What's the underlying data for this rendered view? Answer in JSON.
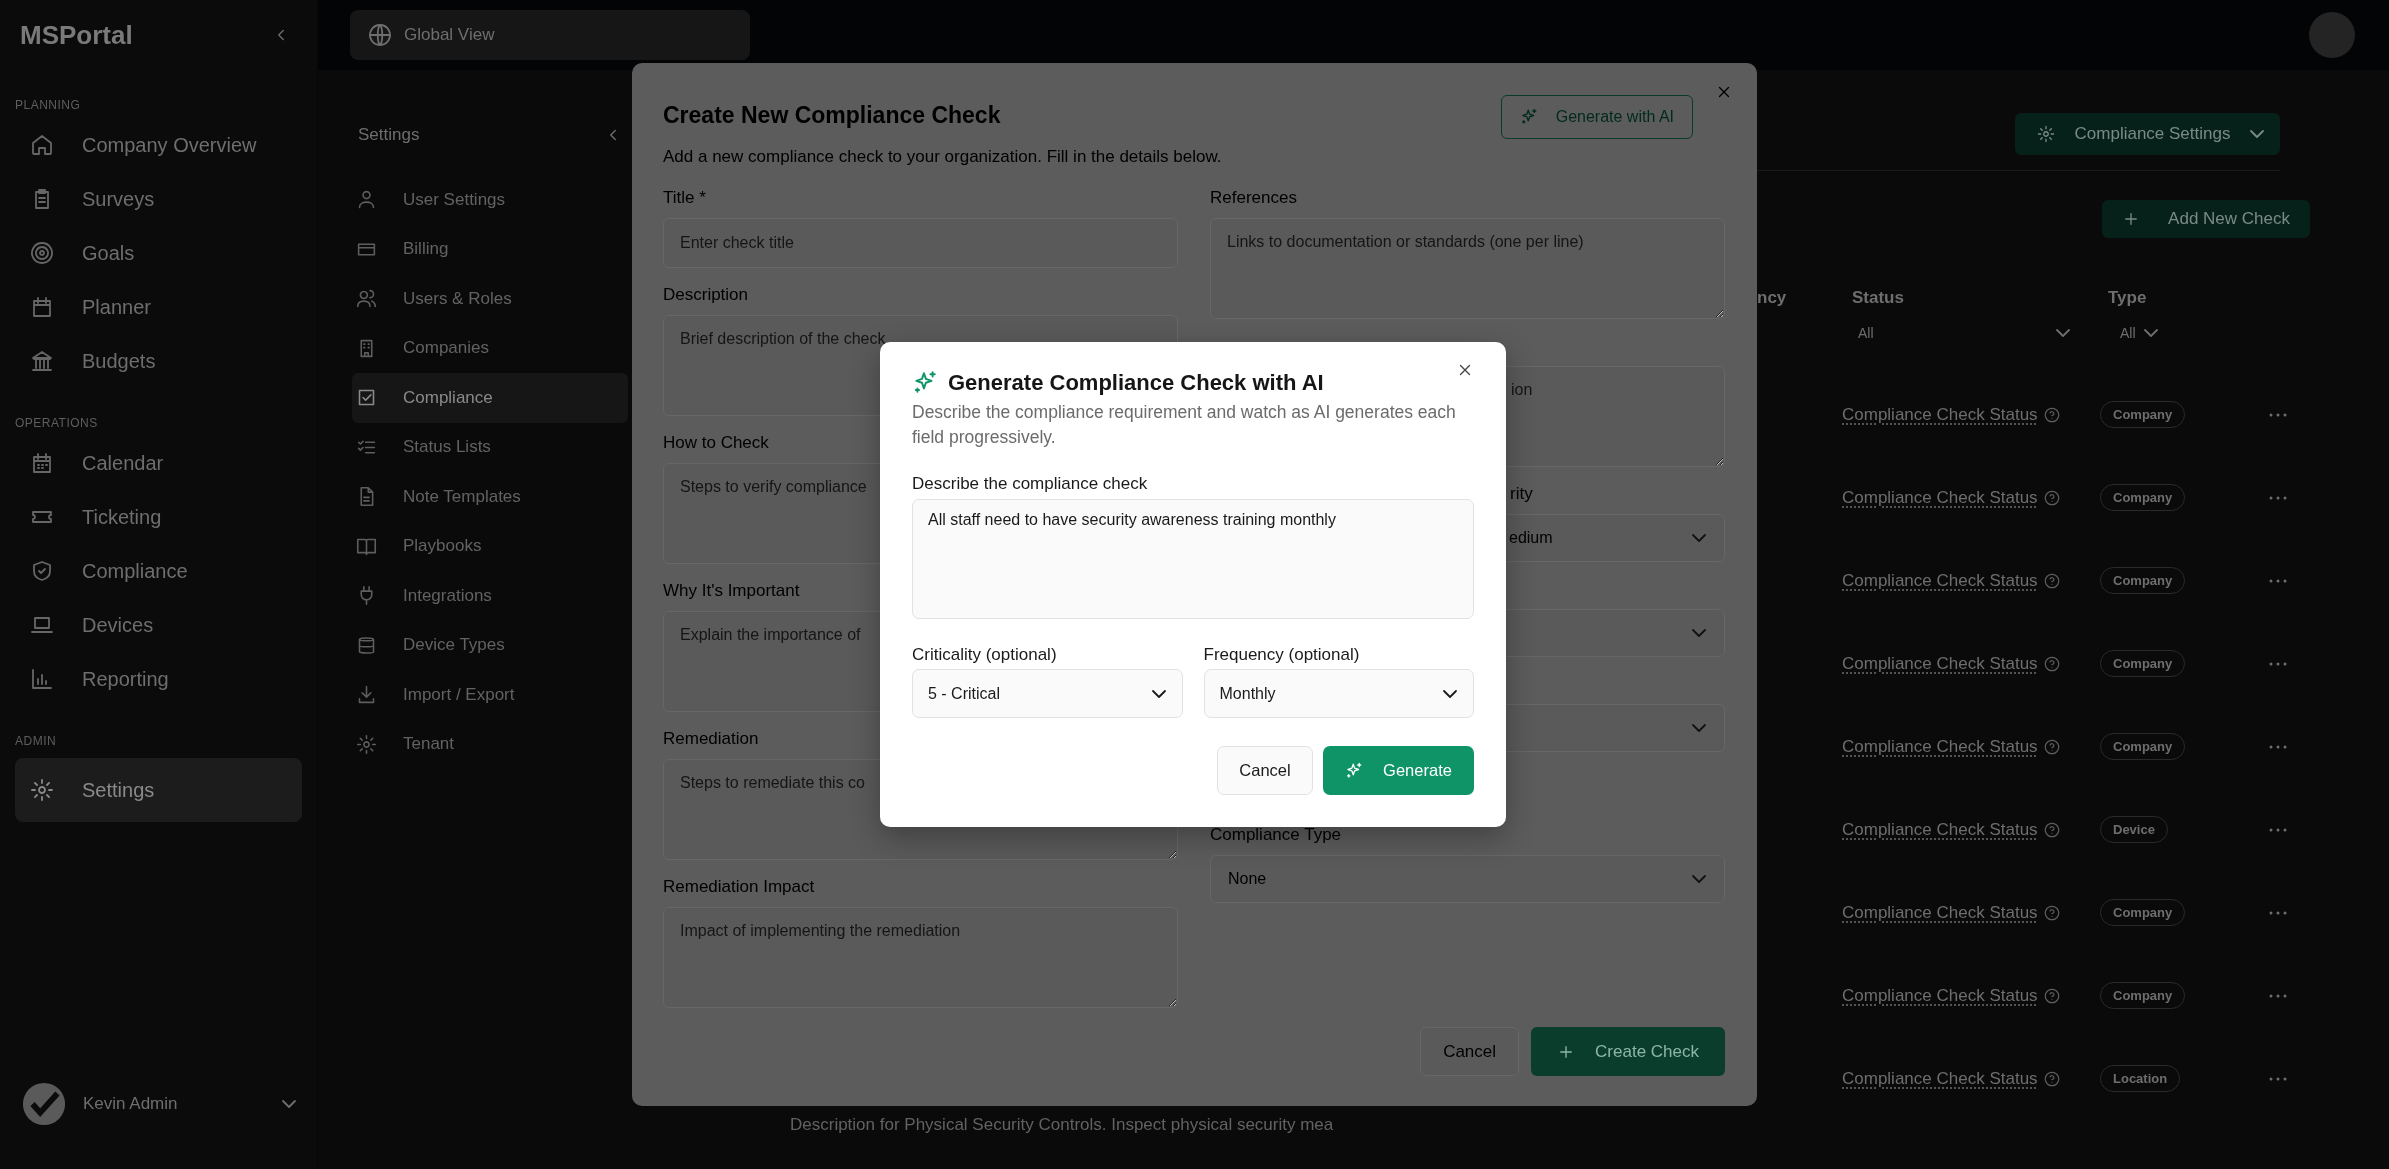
{
  "sidebar": {
    "logo": "MSPortal",
    "sections": [
      {
        "label": "PLANNING",
        "items": [
          {
            "label": "Company Overview",
            "selected": false
          },
          {
            "label": "Surveys",
            "selected": false
          },
          {
            "label": "Goals",
            "selected": false
          },
          {
            "label": "Planner",
            "selected": false
          },
          {
            "label": "Budgets",
            "selected": false
          }
        ]
      },
      {
        "label": "OPERATIONS",
        "items": [
          {
            "label": "Calendar",
            "selected": false
          },
          {
            "label": "Ticketing",
            "selected": false
          },
          {
            "label": "Compliance",
            "selected": false
          },
          {
            "label": "Devices",
            "selected": false
          },
          {
            "label": "Reporting",
            "selected": false
          }
        ]
      },
      {
        "label": "ADMIN",
        "items": [
          {
            "label": "Settings",
            "selected": true
          }
        ]
      }
    ],
    "user": {
      "name": "Kevin Admin"
    }
  },
  "top_bar": {
    "scope": "Global View"
  },
  "settings_nav": {
    "title": "Settings",
    "items": [
      {
        "label": "User Settings",
        "selected": false
      },
      {
        "label": "Billing",
        "selected": false
      },
      {
        "label": "Users & Roles",
        "selected": false
      },
      {
        "label": "Companies",
        "selected": false
      },
      {
        "label": "Compliance",
        "selected": true
      },
      {
        "label": "Status Lists",
        "selected": false
      },
      {
        "label": "Note Templates",
        "selected": false
      },
      {
        "label": "Playbooks",
        "selected": false
      },
      {
        "label": "Integrations",
        "selected": false
      },
      {
        "label": "Device Types",
        "selected": false
      },
      {
        "label": "Import / Export",
        "selected": false
      },
      {
        "label": "Tenant",
        "selected": false
      }
    ]
  },
  "page": {
    "settings_button": "Compliance Settings",
    "add_button": "Add New Check",
    "table": {
      "columns": [
        "ncy",
        "Status",
        "Type"
      ],
      "filters": [
        "All",
        "All"
      ],
      "rows": [
        {
          "status": "Compliance Check Status",
          "type": "Company"
        },
        {
          "status": "Compliance Check Status",
          "type": "Company"
        },
        {
          "status": "Compliance Check Status",
          "type": "Company"
        },
        {
          "status": "Compliance Check Status",
          "type": "Company"
        },
        {
          "status": "Compliance Check Status",
          "type": "Company"
        },
        {
          "status": "Compliance Check Status",
          "type": "Device"
        },
        {
          "status": "Compliance Check Status",
          "type": "Company"
        },
        {
          "status": "Compliance Check Status",
          "type": "Company"
        },
        {
          "status": "Compliance Check Status",
          "type": "Location"
        }
      ]
    },
    "description": "Description for Physical Security Controls. Inspect physical security mea"
  },
  "create_dialog": {
    "title": "Create New Compliance Check",
    "ai_button": "Generate with AI",
    "subtitle": "Add a new compliance check to your organization. Fill in the details below.",
    "left_fields": [
      {
        "kind": "input",
        "label": "Title *",
        "placeholder": "Enter check title"
      },
      {
        "kind": "textarea",
        "label": "Description",
        "placeholder": "Brief description of the check"
      },
      {
        "kind": "textarea",
        "label": "How to Check",
        "placeholder": "Steps to verify compliance"
      },
      {
        "kind": "textarea",
        "label": "Why It's Important",
        "placeholder": "Explain the importance of"
      },
      {
        "kind": "textarea",
        "label": "Remediation",
        "placeholder": "Steps to remediate this co"
      },
      {
        "kind": "textarea",
        "label": "Remediation Impact",
        "placeholder": "Impact of implementing the remediation"
      }
    ],
    "right_fields": [
      {
        "kind": "textarea",
        "label": "References",
        "placeholder": "Links to documentation or standards (one per line)"
      },
      {
        "kind": "textarea",
        "placeholder": "ion"
      },
      {
        "kind": "select",
        "label": "rity",
        "value": "edium"
      },
      {
        "kind": "select"
      },
      {
        "kind": "select"
      },
      {
        "kind": "select",
        "label": "Compliance Type",
        "value": "None"
      }
    ],
    "cancel": "Cancel",
    "create": "Create Check"
  },
  "ai_dialog": {
    "title": "Generate Compliance Check with AI",
    "subtitle": "Describe the compliance requirement and watch as AI generates each field progressively.",
    "prompt_label": "Describe the compliance check",
    "prompt": "All staff need to have security awareness training monthly",
    "selects": [
      {
        "label": "Criticality (optional)",
        "value": "5 - Critical"
      },
      {
        "label": "Frequency (optional)",
        "value": "Monthly"
      }
    ],
    "cancel": "Cancel",
    "generate": "Generate"
  }
}
